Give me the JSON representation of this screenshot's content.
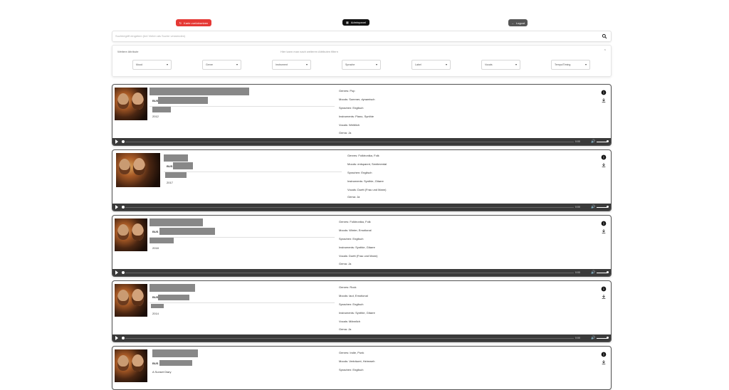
{
  "toolbar": {
    "shuffle_label": "Karte zurücksetzen",
    "admin_label": "Adminpanel",
    "logout_label": "Logout"
  },
  "search": {
    "placeholder": "Suchbegriff eingeben (bei Vielen als Suche verwenden)"
  },
  "filters": {
    "title": "Weitere Attribute",
    "hint": "Hier kann man nach weiteren Attributen filtern",
    "selects": [
      "Mood",
      "Genre",
      "Instrument",
      "Sprache",
      "Label",
      "Vocals",
      "Tempo/Timing"
    ]
  },
  "songs": [
    {
      "badge": "BUS",
      "year": "2012",
      "genres": "Genres: Pop",
      "moods": "Moods: Sommer, dynamisch",
      "languages": "Sprachen: Englisch",
      "instruments": "Instruments: Piano, Synthie",
      "vocals": "Vocals: Weiblich",
      "gema": "Gema: Ja",
      "time": "0:00"
    },
    {
      "badge": "BUS",
      "year": "2017",
      "genres": "Genres: Folktronika, Folk",
      "moods": "Moods: entspannt, Sentimental",
      "languages": "Sprachen: Englisch",
      "instruments": "Instruments: Synthie, Gitarre",
      "vocals": "Vocals: Duett (Frau und Mann)",
      "gema": "Gema: Ja",
      "time": "0:00"
    },
    {
      "badge": "BUS",
      "year": "2018",
      "genres": "Genres: Folktronika, Folk",
      "moods": "Moods: Winter, Emotional",
      "languages": "Sprachen: Englisch",
      "instruments": "Instruments: Synthie, Gitarre",
      "vocals": "Vocals: Duett (Frau und Mann)",
      "gema": "Gema: Ja",
      "time": "0:00"
    },
    {
      "badge": "BUS",
      "year": "2014",
      "genres": "Genres: Rock",
      "moods": "Moods: laut, Emotional",
      "languages": "Sprachen: Englisch",
      "instruments": "Instruments: Synthie, Gitarre",
      "vocals": "Vocals: Männlich",
      "gema": "Gema: Ja",
      "time": "0:00"
    },
    {
      "badge": "BUS",
      "subtitle": "A Sunset Diary",
      "genres": "Genres: Indie, Punk",
      "moods": "Moods: Verträumt, Heimweh",
      "languages": "Sprachen: Englisch"
    }
  ]
}
